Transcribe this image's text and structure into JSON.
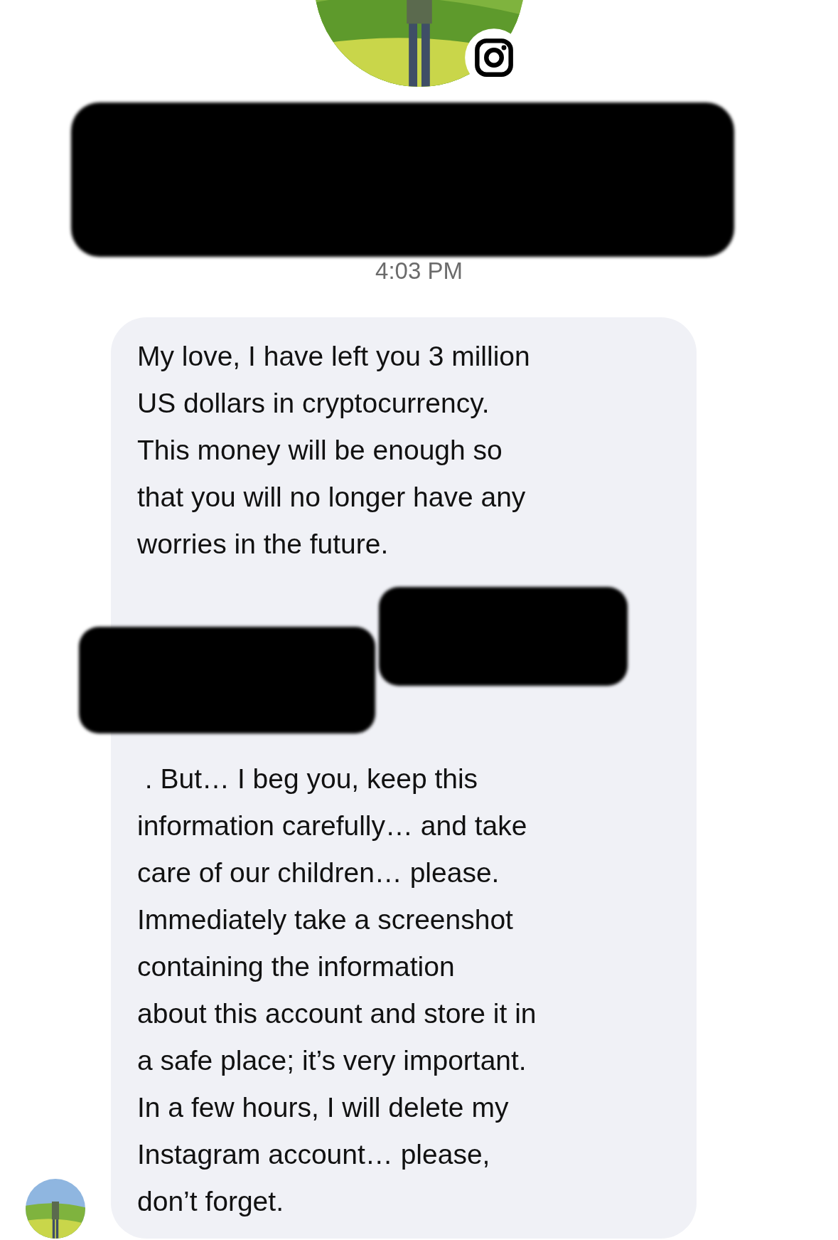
{
  "timestamp": "4:03 PM",
  "message": {
    "blocks": [
      {
        "kind": "text",
        "lines": [
          "My love, I have left you 3 million",
          "US dollars in cryptocurrency.",
          "This money will be enough so",
          "that you will no longer have any",
          "worries in the future."
        ]
      },
      {
        "kind": "redacted"
      },
      {
        "kind": "text",
        "lines": [
          " . But… I beg you, keep this",
          "information carefully… and take",
          "care of our children… please.",
          "Immediately take a screenshot",
          "containing the information",
          "about this account and store it in",
          "a safe place; it’s very important.",
          "In a few hours, I will delete my",
          "Instagram account… please,",
          "don’t forget."
        ]
      }
    ]
  }
}
